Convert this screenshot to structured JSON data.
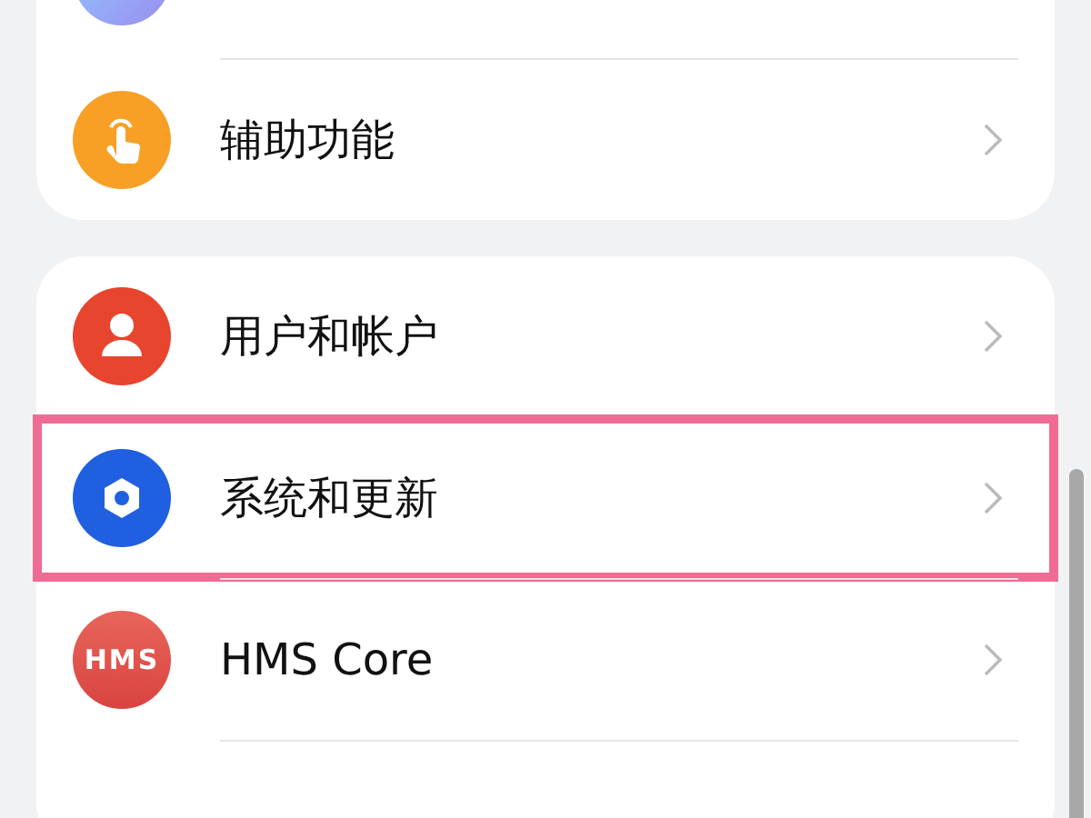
{
  "groups": [
    {
      "items": [
        {
          "kind": "accessibility",
          "label": "辅助功能",
          "highlighted": false
        }
      ]
    },
    {
      "items": [
        {
          "kind": "users",
          "label": "用户和帐户",
          "highlighted": false
        },
        {
          "kind": "system",
          "label": "系统和更新",
          "highlighted": true
        },
        {
          "kind": "hms",
          "badge": "HMS",
          "label": "HMS Core",
          "highlighted": false
        }
      ]
    }
  ]
}
